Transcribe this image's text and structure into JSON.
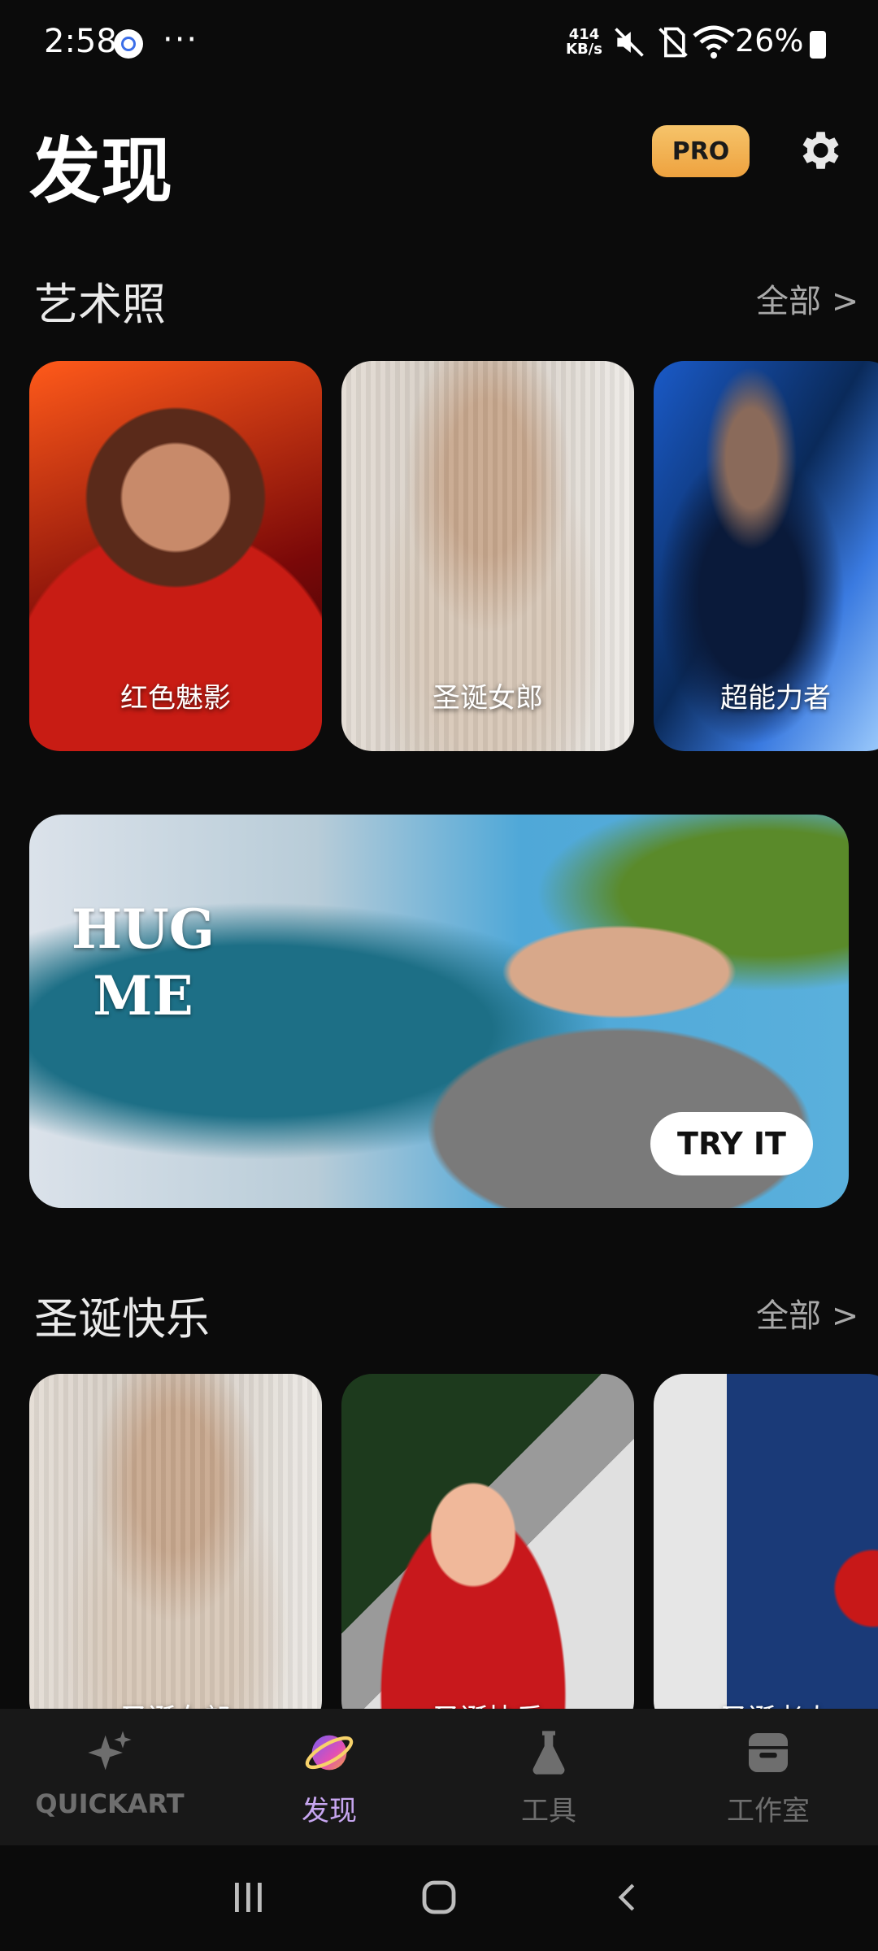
{
  "status_bar": {
    "time": "2:58",
    "dots": "···",
    "net_speed_top": "414",
    "net_speed_bottom": "KB/s",
    "battery": "26%"
  },
  "header": {
    "title": "发现",
    "pro_label": "PRO"
  },
  "sections": {
    "art": {
      "title": "艺术照",
      "see_all": "全部 >",
      "cards": [
        {
          "label": "红色魅影"
        },
        {
          "label": "圣诞女郎"
        },
        {
          "label": "超能力者"
        }
      ]
    },
    "banner": {
      "text_line1": "HUG",
      "text_line2": "ME",
      "button": "TRY IT"
    },
    "christmas": {
      "title": "圣诞快乐",
      "see_all": "全部 >",
      "cards": [
        {
          "label": "圣诞女郎"
        },
        {
          "label": "圣诞快乐"
        },
        {
          "label": "圣诞老人"
        }
      ]
    }
  },
  "bottom_nav": {
    "items": [
      {
        "label": "QUICKART",
        "icon": "sparkle-icon",
        "active": false
      },
      {
        "label": "发现",
        "icon": "planet-icon",
        "active": true
      },
      {
        "label": "工具",
        "icon": "flask-icon",
        "active": false
      },
      {
        "label": "工作室",
        "icon": "archive-icon",
        "active": false
      }
    ]
  },
  "colors": {
    "background": "#0b0b0b",
    "pro": "#f2b455",
    "active_nav": "#c7a6f0"
  }
}
